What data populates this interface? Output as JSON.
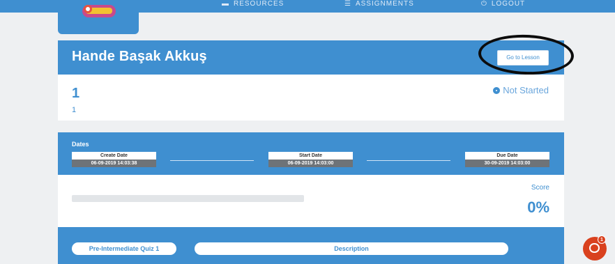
{
  "nav": {
    "items": [
      {
        "label": "RESOURCES",
        "icon": "book-icon"
      },
      {
        "label": "ASSIGNMENTS",
        "icon": "list-icon"
      },
      {
        "label": "LOGOUT",
        "icon": "power-icon"
      }
    ]
  },
  "header": {
    "title": "Hande Başak Akkuş",
    "go_button": "Go to Lesson"
  },
  "info": {
    "number": "1",
    "subtext": "1",
    "status": "Not Started"
  },
  "dates": {
    "label": "Dates",
    "create": {
      "title": "Create Date",
      "value": "06-09-2019 14:03:38"
    },
    "start": {
      "title": "Start Date",
      "value": "06-09-2019 14:03:00"
    },
    "due": {
      "title": "Due Date",
      "value": "30-09-2019 14:03:00"
    }
  },
  "score": {
    "label": "Score",
    "value": "0%",
    "progress": 0
  },
  "quiz": {
    "name": "Pre-Intermediate Quiz 1",
    "description_header": "Description"
  },
  "chat": {
    "badge": "1"
  },
  "colors": {
    "primary": "#3f8fd0",
    "chat": "#d9411e"
  }
}
